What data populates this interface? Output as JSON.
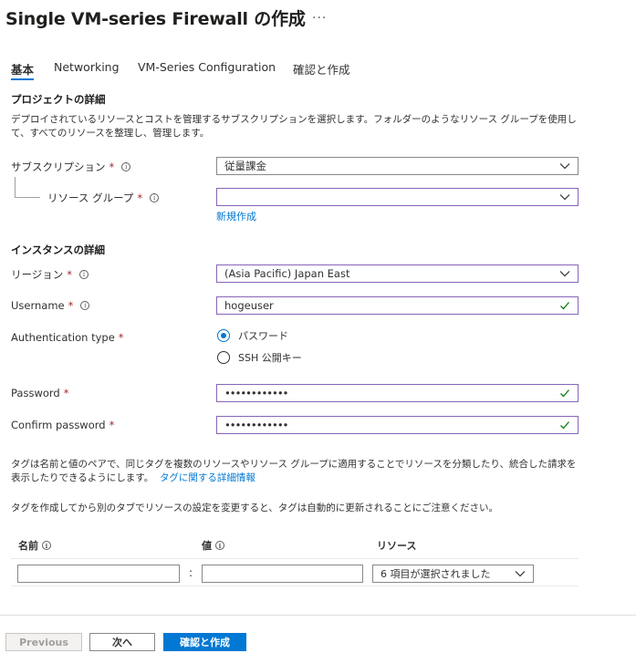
{
  "header": {
    "title": "Single VM-series Firewall の作成",
    "more": "..."
  },
  "tabs": [
    {
      "label": "基本",
      "active": true
    },
    {
      "label": "Networking"
    },
    {
      "label": "VM-Series Configuration"
    },
    {
      "label": "確認と作成"
    }
  ],
  "project": {
    "title": "プロジェクトの詳細",
    "description": "デプロイされているリソースとコストを管理するサブスクリプションを選択します。フォルダーのようなリソース グループを使用して、すべてのリソースを整理し、管理します。",
    "subscription": {
      "label": "サブスクリプション",
      "value": "従量課金"
    },
    "resource_group": {
      "label": "リソース グループ",
      "value": "",
      "create_new": "新規作成"
    }
  },
  "instance": {
    "title": "インスタンスの詳細",
    "region": {
      "label": "リージョン",
      "value": "(Asia Pacific) Japan East"
    },
    "username": {
      "label": "Username",
      "value": "hogeuser"
    },
    "auth_type": {
      "label": "Authentication type",
      "options": [
        "パスワード",
        "SSH 公開キー"
      ],
      "selected": "パスワード"
    },
    "password": {
      "label": "Password",
      "value": "••••••••••••"
    },
    "confirm_password": {
      "label": "Confirm password",
      "value": "••••••••••••"
    }
  },
  "tags": {
    "description": "タグは名前と値のペアで、同じタグを複数のリソースやリソース グループに適用することでリソースを分類したり、統合した請求を表示したりできるようにします。",
    "learn_more": "タグに関する詳細情報",
    "note": "タグを作成してから別のタブでリソースの設定を変更すると、タグは自動的に更新されることにご注意ください。",
    "columns": {
      "name": "名前",
      "value": "値",
      "resource": "リソース"
    },
    "separator": ":",
    "resource_selected": "6 項目が選択されました"
  },
  "footer": {
    "previous": "Previous",
    "next": "次へ",
    "review_create": "確認と作成"
  },
  "colors": {
    "accent": "#0078d4",
    "required": "#a4262c",
    "focus_border": "#8764b8",
    "valid_check": "#107c10"
  },
  "icons": {
    "info": "info-icon",
    "chevron": "chevron-down-icon",
    "check": "checkmark-icon"
  }
}
